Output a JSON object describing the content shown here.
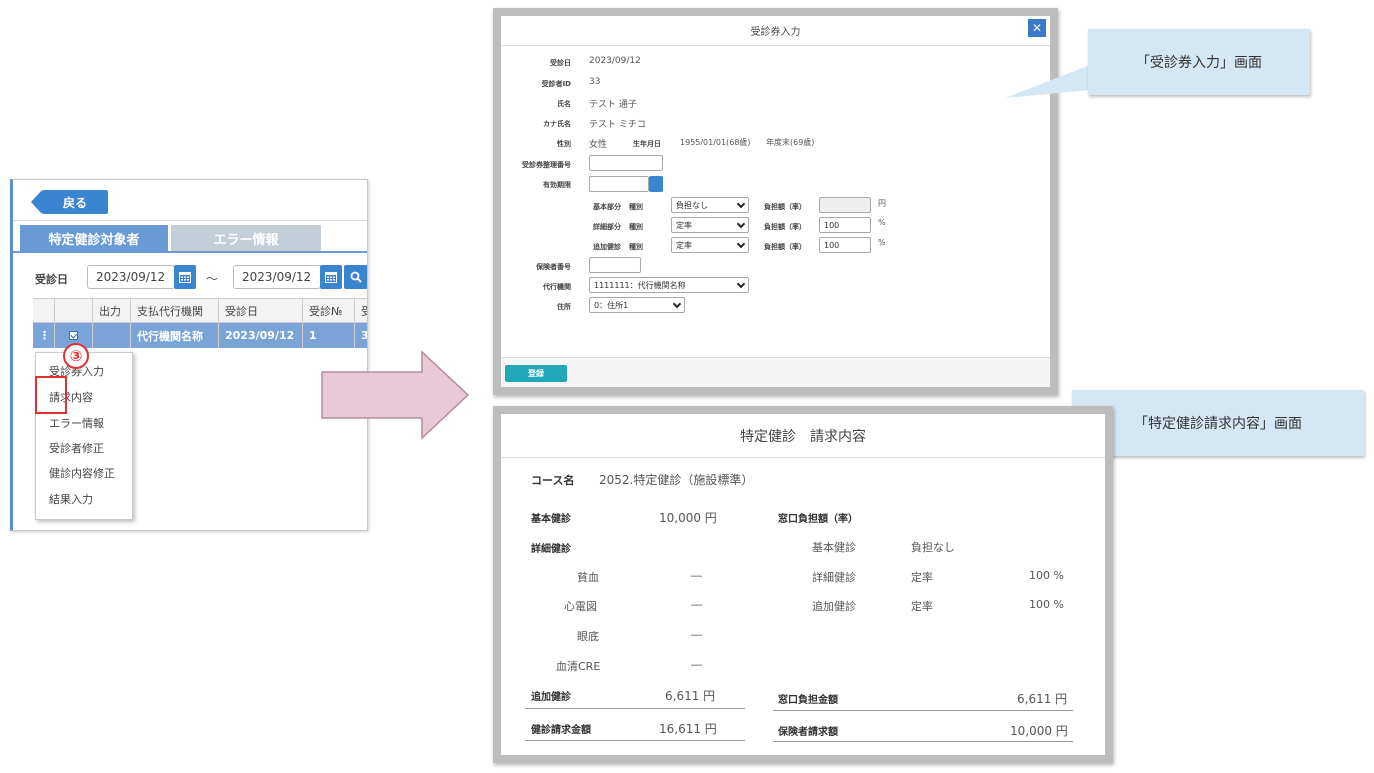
{
  "left": {
    "back_label": "戻る",
    "tabs": [
      "特定健診対象者",
      "エラー情報"
    ],
    "date_label": "受診日",
    "date_from": "2023/09/12",
    "date_to": "2023/09/12",
    "tilde": "～",
    "grid_headers": [
      "",
      "",
      "出力",
      "支払代行機関",
      "受診日",
      "受診№",
      "受"
    ],
    "row": {
      "menu": "⋮",
      "agency": "代行機関名称",
      "date": "2023/09/12",
      "no": "1",
      "extra": "3"
    },
    "step": "③",
    "menu_items": [
      "受診券入力",
      "請求内容",
      "エラー情報",
      "受診者修正",
      "健診内容修正",
      "結果入力"
    ]
  },
  "top_dialog": {
    "title": "受診券入力",
    "close": "✕",
    "labels": {
      "date": "受診日",
      "id": "受診者ID",
      "name": "氏名",
      "kana": "カナ氏名",
      "sex": "性別",
      "dob_label": "生年月日",
      "ticket_no": "受診券整理番号",
      "expiry": "有効期限",
      "insurer_no": "保険者番号",
      "agency": "代行機関",
      "address": "住所"
    },
    "values": {
      "date": "2023/09/12",
      "id": "33",
      "name": "テスト 通子",
      "kana": "テスト ミチコ",
      "sex": "女性",
      "dob": "1955/01/01(68歳)",
      "age_end": "年度末(69歳)"
    },
    "burden_rows": [
      {
        "part": "基本部分",
        "kind_label": "種別",
        "kind": "負担なし",
        "amount_label": "負担額（率）",
        "amount": "",
        "unit": "円"
      },
      {
        "part": "詳細部分",
        "kind_label": "種別",
        "kind": "定率",
        "amount_label": "負担額（率）",
        "amount": "100",
        "unit": "%"
      },
      {
        "part": "追加健診",
        "kind_label": "種別",
        "kind": "定率",
        "amount_label": "負担額（率）",
        "amount": "100",
        "unit": "%"
      }
    ],
    "agency_value": "1111111：代行機関名称",
    "address_value": "0：住所1",
    "register": "登録"
  },
  "callouts": {
    "c1": "「受診券入力」画面",
    "c2": "「特定健診請求内容」画面"
  },
  "bottom_dialog": {
    "title": "特定健診　請求内容",
    "course_label": "コース名",
    "course_value": "2052.特定健診（施設標準）",
    "basic_label": "基本健診",
    "basic_value": "10,000 円",
    "detail_label": "詳細健診",
    "detail_items": [
      {
        "name": "貧血",
        "value": "―"
      },
      {
        "name": "心電図",
        "value": "―"
      },
      {
        "name": "眼底",
        "value": "―"
      },
      {
        "name": "血清CRE",
        "value": "―"
      }
    ],
    "additional_label": "追加健診",
    "additional_value": "6,611 円",
    "total_label": "健診請求金額",
    "total_value": "16,611 円",
    "window_label": "窓口負担額（率）",
    "window_items": [
      {
        "name": "基本健診",
        "kind": "負担なし",
        "rate": ""
      },
      {
        "name": "詳細健診",
        "kind": "定率",
        "rate": "100 %"
      },
      {
        "name": "追加健診",
        "kind": "定率",
        "rate": "100 %"
      }
    ],
    "window_amount_label": "窓口負担金額",
    "window_amount_value": "6,611 円",
    "insurer_label": "保険者請求額",
    "insurer_value": "10,000 円"
  }
}
